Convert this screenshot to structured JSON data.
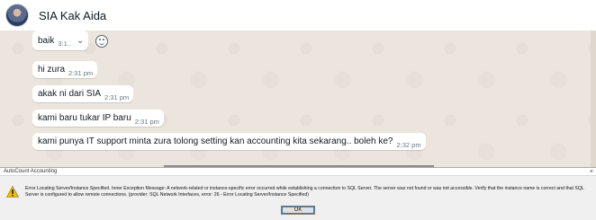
{
  "chat": {
    "title": "SIA Kak Aida",
    "messages": [
      {
        "text": "baik",
        "time": "3:1.."
      },
      {
        "text": "hi zura",
        "time": "2:31 pm"
      },
      {
        "text": "akak ni dari SIA",
        "time": "2:31 pm"
      },
      {
        "text": "kami baru tukar IP baru",
        "time": "2:31 pm"
      },
      {
        "text": "kami punya IT support minta zura tolong setting kan accounting kita sekarang.. boleh ke?",
        "time": "2:32 pm"
      }
    ]
  },
  "icons": {
    "avatar": "contact-avatar",
    "chevron": "chevron-down-icon",
    "emoji": "emoji-icon",
    "warning": "warning-icon",
    "close": "close-icon"
  },
  "dialog": {
    "title": "AutoCount Accounting",
    "close_label": "×",
    "message": "Error Locating Server/Instance Specified. Inner Exception Message: A network-related or instance-specific error occurred while establishing a connection to SQL Server. The server was not found or was not accessible. Verify that the instance name is correct and that SQL Server is configured to allow remote connections. (provider: SQL Network Interfaces, error: 26 - Error Locating Server/Instance Specified)",
    "ok_label": "OK"
  },
  "colors": {
    "chat_background": "#ece5dd",
    "bubble": "#ffffff",
    "dialog_background": "#f0f0f0",
    "warning": "#f2c200"
  }
}
